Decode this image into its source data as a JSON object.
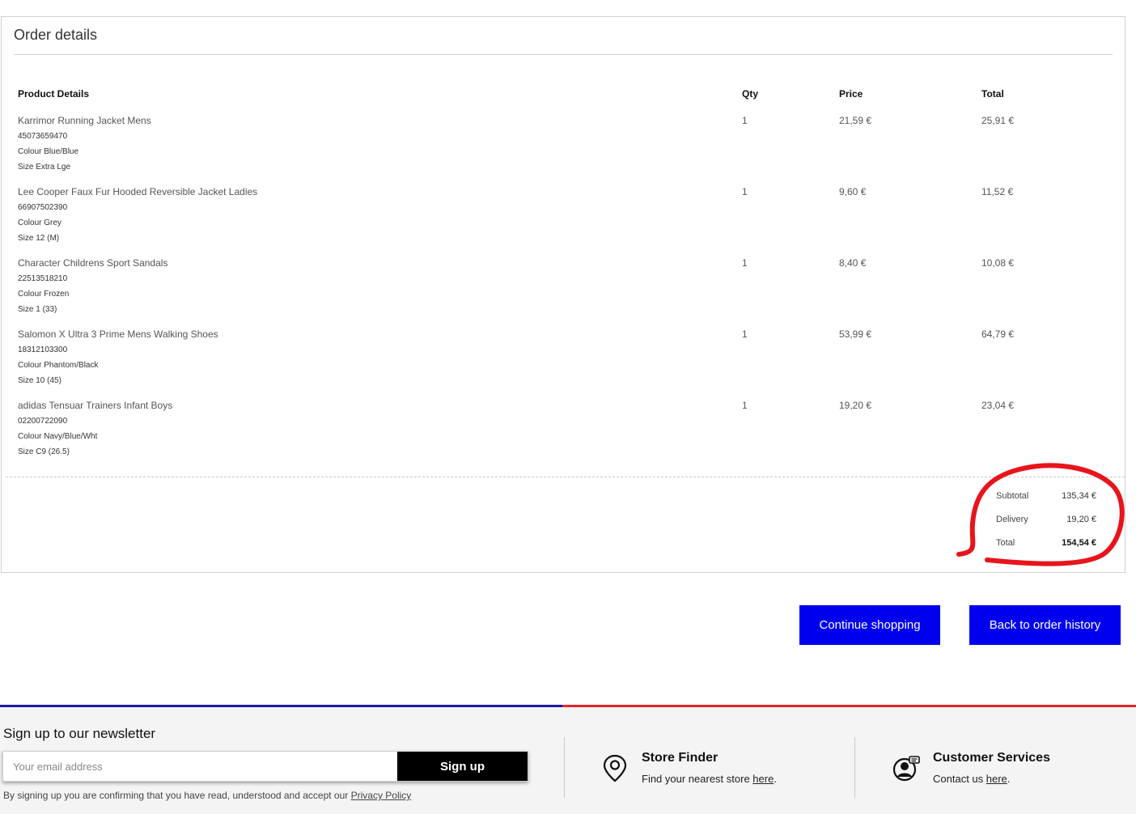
{
  "order": {
    "title": "Order details",
    "headers": {
      "product": "Product Details",
      "qty": "Qty",
      "price": "Price",
      "total": "Total"
    },
    "items": [
      {
        "name": "Karrimor Running Jacket Mens",
        "sku": "45073659470",
        "colour": "Colour Blue/Blue",
        "size": "Size Extra Lge",
        "qty": "1",
        "price": "21,59 €",
        "total": "25,91 €"
      },
      {
        "name": "Lee Cooper Faux Fur Hooded Reversible Jacket Ladies",
        "sku": "66907502390",
        "colour": "Colour Grey",
        "size": "Size 12 (M)",
        "qty": "1",
        "price": "9,60 €",
        "total": "11,52 €"
      },
      {
        "name": "Character Childrens Sport Sandals",
        "sku": "22513518210",
        "colour": "Colour Frozen",
        "size": "Size 1 (33)",
        "qty": "1",
        "price": "8,40 €",
        "total": "10,08 €"
      },
      {
        "name": "Salomon X Ultra 3 Prime Mens Walking Shoes",
        "sku": "18312103300",
        "colour": "Colour Phantom/Black",
        "size": "Size 10 (45)",
        "qty": "1",
        "price": "53,99 €",
        "total": "64,79 €"
      },
      {
        "name": "adidas Tensuar Trainers Infant Boys",
        "sku": "02200722090",
        "colour": "Colour Navy/Blue/Wht",
        "size": "Size C9 (26.5)",
        "qty": "1",
        "price": "19,20 €",
        "total": "23,04 €"
      }
    ],
    "summary": {
      "subtotal_label": "Subtotal",
      "subtotal_value": "135,34 €",
      "delivery_label": "Delivery",
      "delivery_value": "19,20 €",
      "total_label": "Total",
      "total_value": "154,54 €"
    },
    "annotation_color": "#e8141c"
  },
  "actions": {
    "continue_label": "Continue shopping",
    "back_label": "Back to order history",
    "button_color": "#0000ee"
  },
  "footer": {
    "newsletter": {
      "title": "Sign up to our newsletter",
      "placeholder": "Your email address",
      "button": "Sign up",
      "consent_prefix": "By signing up you are confirming that you have read, understood and accept our ",
      "consent_link": "Privacy Policy"
    },
    "store_finder": {
      "icon": "location-pin-icon",
      "title": "Store Finder",
      "text_prefix": "Find your nearest store ",
      "link": "here",
      "text_suffix": "."
    },
    "customer_services": {
      "icon": "customer-support-icon",
      "title": "Customer Services",
      "text_prefix": "Contact us ",
      "link": "here",
      "text_suffix": "."
    }
  }
}
